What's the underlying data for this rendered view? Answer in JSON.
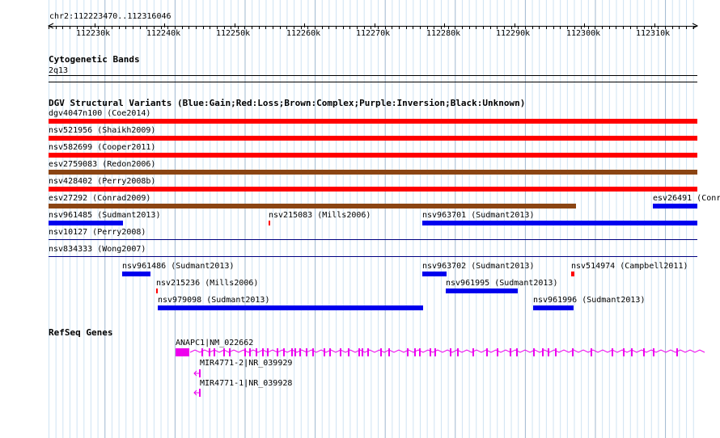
{
  "ruler": {
    "region": "chr2:112223470..112316046",
    "ticks": [
      "112230k",
      "112240k",
      "112250k",
      "112260k",
      "112270k",
      "112280k",
      "112290k",
      "112300k",
      "112310k"
    ]
  },
  "cytoband": {
    "title": "Cytogenetic Bands",
    "band": "2q13"
  },
  "dgv": {
    "title": "DGV Structural Variants (Blue:Gain;Red:Loss;Brown:Complex;Purple:Inversion;Black:Unknown)",
    "colors": {
      "gain": "#0000ee",
      "loss": "#ff0000",
      "complex": "#8b4513",
      "separator": "#000080"
    },
    "features": [
      {
        "label": "dgv4047n100 (Coe2014)"
      },
      {
        "label": "nsv521956 (Shaikh2009)"
      },
      {
        "label": "nsv582699 (Cooper2011)"
      },
      {
        "label": "esv2759083 (Redon2006)"
      },
      {
        "label": "nsv428402 (Perry2008b)"
      },
      {
        "label": "esv27292 (Conrad2009)"
      },
      {
        "label": "esv26491 (Conr"
      },
      {
        "label": "nsv961485 (Sudmant2013)"
      },
      {
        "label": "nsv215083 (Mills2006)"
      },
      {
        "label": "nsv963701 (Sudmant2013)"
      },
      {
        "label": "nsv10127 (Perry2008)"
      },
      {
        "label": "nsv834333 (Wong2007)"
      },
      {
        "label": "nsv961486 (Sudmant2013)"
      },
      {
        "label": "nsv963702 (Sudmant2013)"
      },
      {
        "label": "nsv514974 (Campbell2011)"
      },
      {
        "label": "nsv215236 (Mills2006)"
      },
      {
        "label": "nsv961995 (Sudmant2013)"
      },
      {
        "label": "nsv979098 (Sudmant2013)"
      },
      {
        "label": "nsv961996 (Sudmant2013)"
      }
    ]
  },
  "refseq": {
    "title": "RefSeq Genes",
    "color": "#ee00ee",
    "genes": [
      {
        "label": "ANAPC1|NM_022662"
      },
      {
        "label": "MIR4771-2|NR_039929"
      },
      {
        "label": "MIR4771-1|NR_039928"
      }
    ]
  }
}
